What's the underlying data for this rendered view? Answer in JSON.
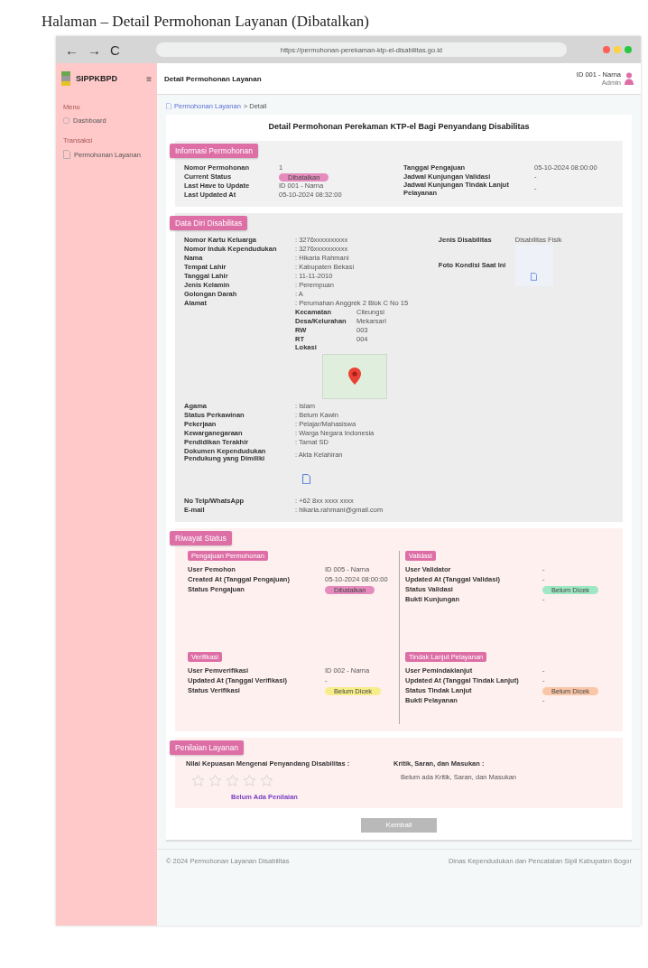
{
  "page_title": "Halaman – Detail Permohonan Layanan (Dibatalkan)",
  "browser": {
    "back": "←",
    "forward": "→",
    "reload": "C",
    "url": "https://permohonan-perekaman-ktp-el-disabilitas.go.id"
  },
  "sidebar": {
    "brand": "SIPPKBPD",
    "menu_icon": "≡",
    "groups": [
      {
        "label": "Menu",
        "items": [
          {
            "label": "Dashboard",
            "kind": "dashboard"
          }
        ]
      },
      {
        "label": "Transaksi",
        "items": [
          {
            "label": "Permohonan Layanan",
            "kind": "document"
          }
        ]
      }
    ]
  },
  "header": {
    "title": "Detail Permohonan Layanan",
    "user_name": "ID 001 - Narna",
    "user_role": "Admin"
  },
  "breadcrumb": {
    "parent": "Permohonan Layanan",
    "current": "> Detail"
  },
  "card_title": "Detail Permohonan Perekaman KTP-el Bagi Penyandang Disabilitas",
  "info": {
    "title": "Informasi Permohonan",
    "left": [
      {
        "label": "Nomor Permohonan",
        "value": "1",
        "kind": "text"
      },
      {
        "label": "Current Status",
        "value": "Dibatalkan",
        "kind": "badge",
        "color": "#e58bbd"
      },
      {
        "label": "Last Have to Update",
        "value": "ID 001 - Narna",
        "kind": "text"
      },
      {
        "label": "Last Updated At",
        "value": "05-10-2024 08:32:00",
        "kind": "text"
      }
    ],
    "right": [
      {
        "label": "Tanggal Pengajuan",
        "value": "05-10-2024 08:00:00",
        "kind": "text"
      },
      {
        "label": "Jadwal Kunjungan Validasi",
        "value": "-",
        "kind": "text"
      },
      {
        "label": "Jadwal Kunjungan Tindak Lanjut Pelayanan",
        "value": "-",
        "kind": "text"
      }
    ]
  },
  "personal": {
    "title": "Data Diri Disabilitas",
    "left": [
      {
        "label": "Nomor Kartu Keluarga",
        "value": ": 3276xxxxxxxxxx",
        "kind": "text"
      },
      {
        "label": "Nomor Induk Kependudukan",
        "value": ": 3276xxxxxxxxxx",
        "kind": "text"
      },
      {
        "label": "Nama",
        "value": ": Hikaria Rahmani",
        "kind": "text"
      },
      {
        "label": "Tempat Lahir",
        "value": ": Kabupaten Bekasi",
        "kind": "text"
      },
      {
        "label": "Tanggal Lahir",
        "value": ": 11-11-2010",
        "kind": "text"
      },
      {
        "label": "Jenis Kelamin",
        "value": ": Perempuan",
        "kind": "text"
      },
      {
        "label": "Golongan Darah",
        "value": ": A",
        "kind": "text"
      },
      {
        "label": "Alamat",
        "value": ": Perumahan Anggrek 2 Blok C No 15",
        "kind": "text"
      },
      {
        "label": "Kecamatan",
        "value": "Cileungsi",
        "kind": "sub"
      },
      {
        "label": "Desa/Kelurahan",
        "value": "Mekarsari",
        "kind": "sub"
      },
      {
        "label": "RW",
        "value": "003",
        "kind": "sub"
      },
      {
        "label": "RT",
        "value": "004",
        "kind": "sub"
      },
      {
        "label": "Lokasi",
        "kind": "map"
      },
      {
        "label": "Agama",
        "value": ": Islam",
        "kind": "text"
      },
      {
        "label": "Status Perkawinan",
        "value": ": Belum Kawin",
        "kind": "text"
      },
      {
        "label": "Pekerjaan",
        "value": ": Pelajar/Mahasiswa",
        "kind": "text"
      },
      {
        "label": "Kewarganegaraan",
        "value": ": Warga Negara Indonesia",
        "kind": "text"
      },
      {
        "label": "Pendidikan Terakhir",
        "value": ": Tamat SD",
        "kind": "text"
      },
      {
        "label": "Dokumen Kependudukan Pendukung yang Dimiliki",
        "value": ": Akta Kelahiran",
        "kind": "text"
      },
      {
        "kind": "file"
      },
      {
        "label": "No Telp/WhatsApp",
        "value": ": +62 8xx xxxx xxxx",
        "kind": "text"
      },
      {
        "label": "E-mail",
        "value": ": hikaria.rahmani@gmail.com",
        "kind": "text"
      }
    ],
    "right": [
      {
        "label": "Jenis Disabilitas",
        "value": "Disabilitas Fisik",
        "kind": "text"
      },
      {
        "label": "Foto Kondisi Saat Ini",
        "kind": "image"
      }
    ]
  },
  "history": {
    "title": "Riwayat Status",
    "groups": [
      {
        "title": "Pengajuan Permohonan",
        "rows": [
          {
            "label": "User Pemohon",
            "value": "ID 005 - Narna",
            "kind": "text"
          },
          {
            "label": "Created At (Tanggal Pengajuan)",
            "value": "05-10-2024 08:00:00",
            "kind": "text"
          },
          {
            "label": "Status Pengajuan",
            "value": "Dibatalkan",
            "kind": "badge",
            "color": "#e58bbd"
          }
        ]
      },
      {
        "title": "Validasi",
        "rows": [
          {
            "label": "User Validator",
            "value": "-",
            "kind": "text"
          },
          {
            "label": "Updated At (Tanggal Validasi)",
            "value": "-",
            "kind": "text"
          },
          {
            "label": "Status Validasi",
            "value": "Belum Dicek",
            "kind": "badge",
            "color": "#9fe8c4"
          },
          {
            "label": "Bukti Kunjungan",
            "value": "-",
            "kind": "text"
          }
        ]
      },
      {
        "title": "Verifikasi",
        "rows": [
          {
            "label": "User Pemverifikasi",
            "value": "ID 002 - Narna",
            "kind": "text"
          },
          {
            "label": "Updated At (Tanggal Verifikasi)",
            "value": "-",
            "kind": "text"
          },
          {
            "label": "Status Verifikasi",
            "value": "Belum Dicek",
            "kind": "badge",
            "color": "#f7ee8a"
          }
        ]
      },
      {
        "title": "Tindak Lanjut Pelayanan",
        "rows": [
          {
            "label": "User Pemindaklanjut",
            "value": "-",
            "kind": "text"
          },
          {
            "label": "Updated At (Tanggal Tindak Lanjut)",
            "value": "-",
            "kind": "text"
          },
          {
            "label": "Status Tindak Lanjut",
            "value": "Belum Dicek",
            "kind": "badge",
            "color": "#f9c7a8"
          },
          {
            "label": "Bukti Pelayanan",
            "value": "-",
            "kind": "text"
          }
        ]
      }
    ]
  },
  "rating": {
    "title": "Penilaian Layanan",
    "score_label": "Nilai Kepuasan Mengenai Penyandang Disabilitas :",
    "stars": 0,
    "score_note": "Belum Ada Penilaian",
    "feedback_label": "Kritik, Saran, dan Masukan :",
    "feedback": "Belum ada Kritik, Saran, dan Masukan"
  },
  "back_button": "Kembali",
  "footer": {
    "left": "© 2024 Permohonan Layanan Disabilitas",
    "right": "Dinas Kependudukan dan Pencatatan Sipil Kabupaten Bogor"
  }
}
